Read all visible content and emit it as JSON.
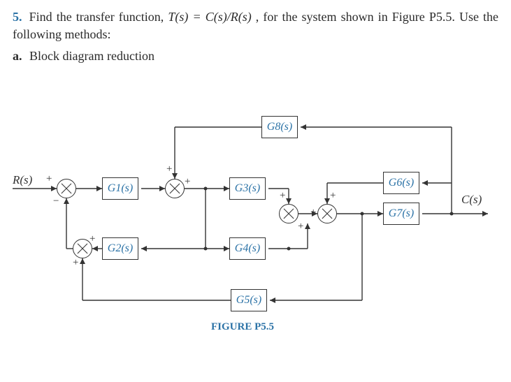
{
  "problem": {
    "number": "5.",
    "text_part1": "Find the transfer function, ",
    "eq": "T(s) = C(s)/R(s)",
    "text_part2": ", for the system shown in Figure P5.5. Use the following methods:",
    "sub_label": "a.",
    "sub_text": "Block diagram reduction"
  },
  "diagram": {
    "input_label": "R(s)",
    "output_label": "C(s)",
    "blocks": {
      "g1": "G1(s)",
      "g2": "G2(s)",
      "g3": "G3(s)",
      "g4": "G4(s)",
      "g5": "G5(s)",
      "g6": "G6(s)",
      "g7": "G7(s)",
      "g8": "G8(s)"
    },
    "signs": {
      "s1_top": "+",
      "s1_bot": "−",
      "s2_top": "+",
      "s2_right": "+",
      "s3_top": "+",
      "s3_bot": "+",
      "s4_left": "+",
      "s4_bot": "+",
      "s5_left": "+",
      "s5_bot": "+"
    },
    "caption": "FIGURE P5.5"
  }
}
